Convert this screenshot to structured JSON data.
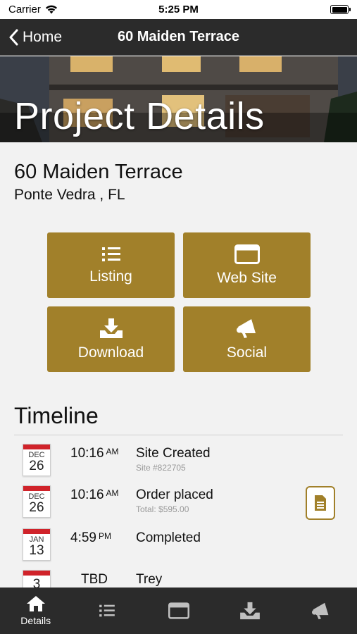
{
  "status": {
    "carrier": "Carrier",
    "time": "5:25 PM"
  },
  "nav": {
    "back_label": "Home",
    "title": "60 Maiden Terrace"
  },
  "hero": {
    "title": "Project Details"
  },
  "address": {
    "street": "60 Maiden Terrace",
    "city": "Ponte Vedra , FL"
  },
  "tiles": [
    {
      "label": "Listing",
      "icon": "list-icon"
    },
    {
      "label": "Web Site",
      "icon": "browser-window-icon"
    },
    {
      "label": "Download",
      "icon": "download-icon"
    },
    {
      "label": "Social",
      "icon": "megaphone-icon"
    }
  ],
  "timeline": {
    "title": "Timeline",
    "items": [
      {
        "month": "DEC",
        "day": "26",
        "time": "10:16",
        "ampm": "AM",
        "event": "Site Created",
        "sub": "Site #822705"
      },
      {
        "month": "DEC",
        "day": "26",
        "time": "10:16",
        "ampm": "AM",
        "event": "Order placed",
        "sub": "Total: $595.00"
      },
      {
        "month": "JAN",
        "day": "13",
        "time": "4:59",
        "ampm": "PM",
        "event": "Completed",
        "sub": ""
      },
      {
        "month": "",
        "day": "3",
        "time": "TBD",
        "ampm": "",
        "event": "Trey",
        "sub": ""
      }
    ]
  },
  "tabbar": {
    "active_label": "Details"
  },
  "colors": {
    "accent": "#a1802a",
    "bar": "#2b2b2b",
    "calendar_red": "#d0232a"
  }
}
